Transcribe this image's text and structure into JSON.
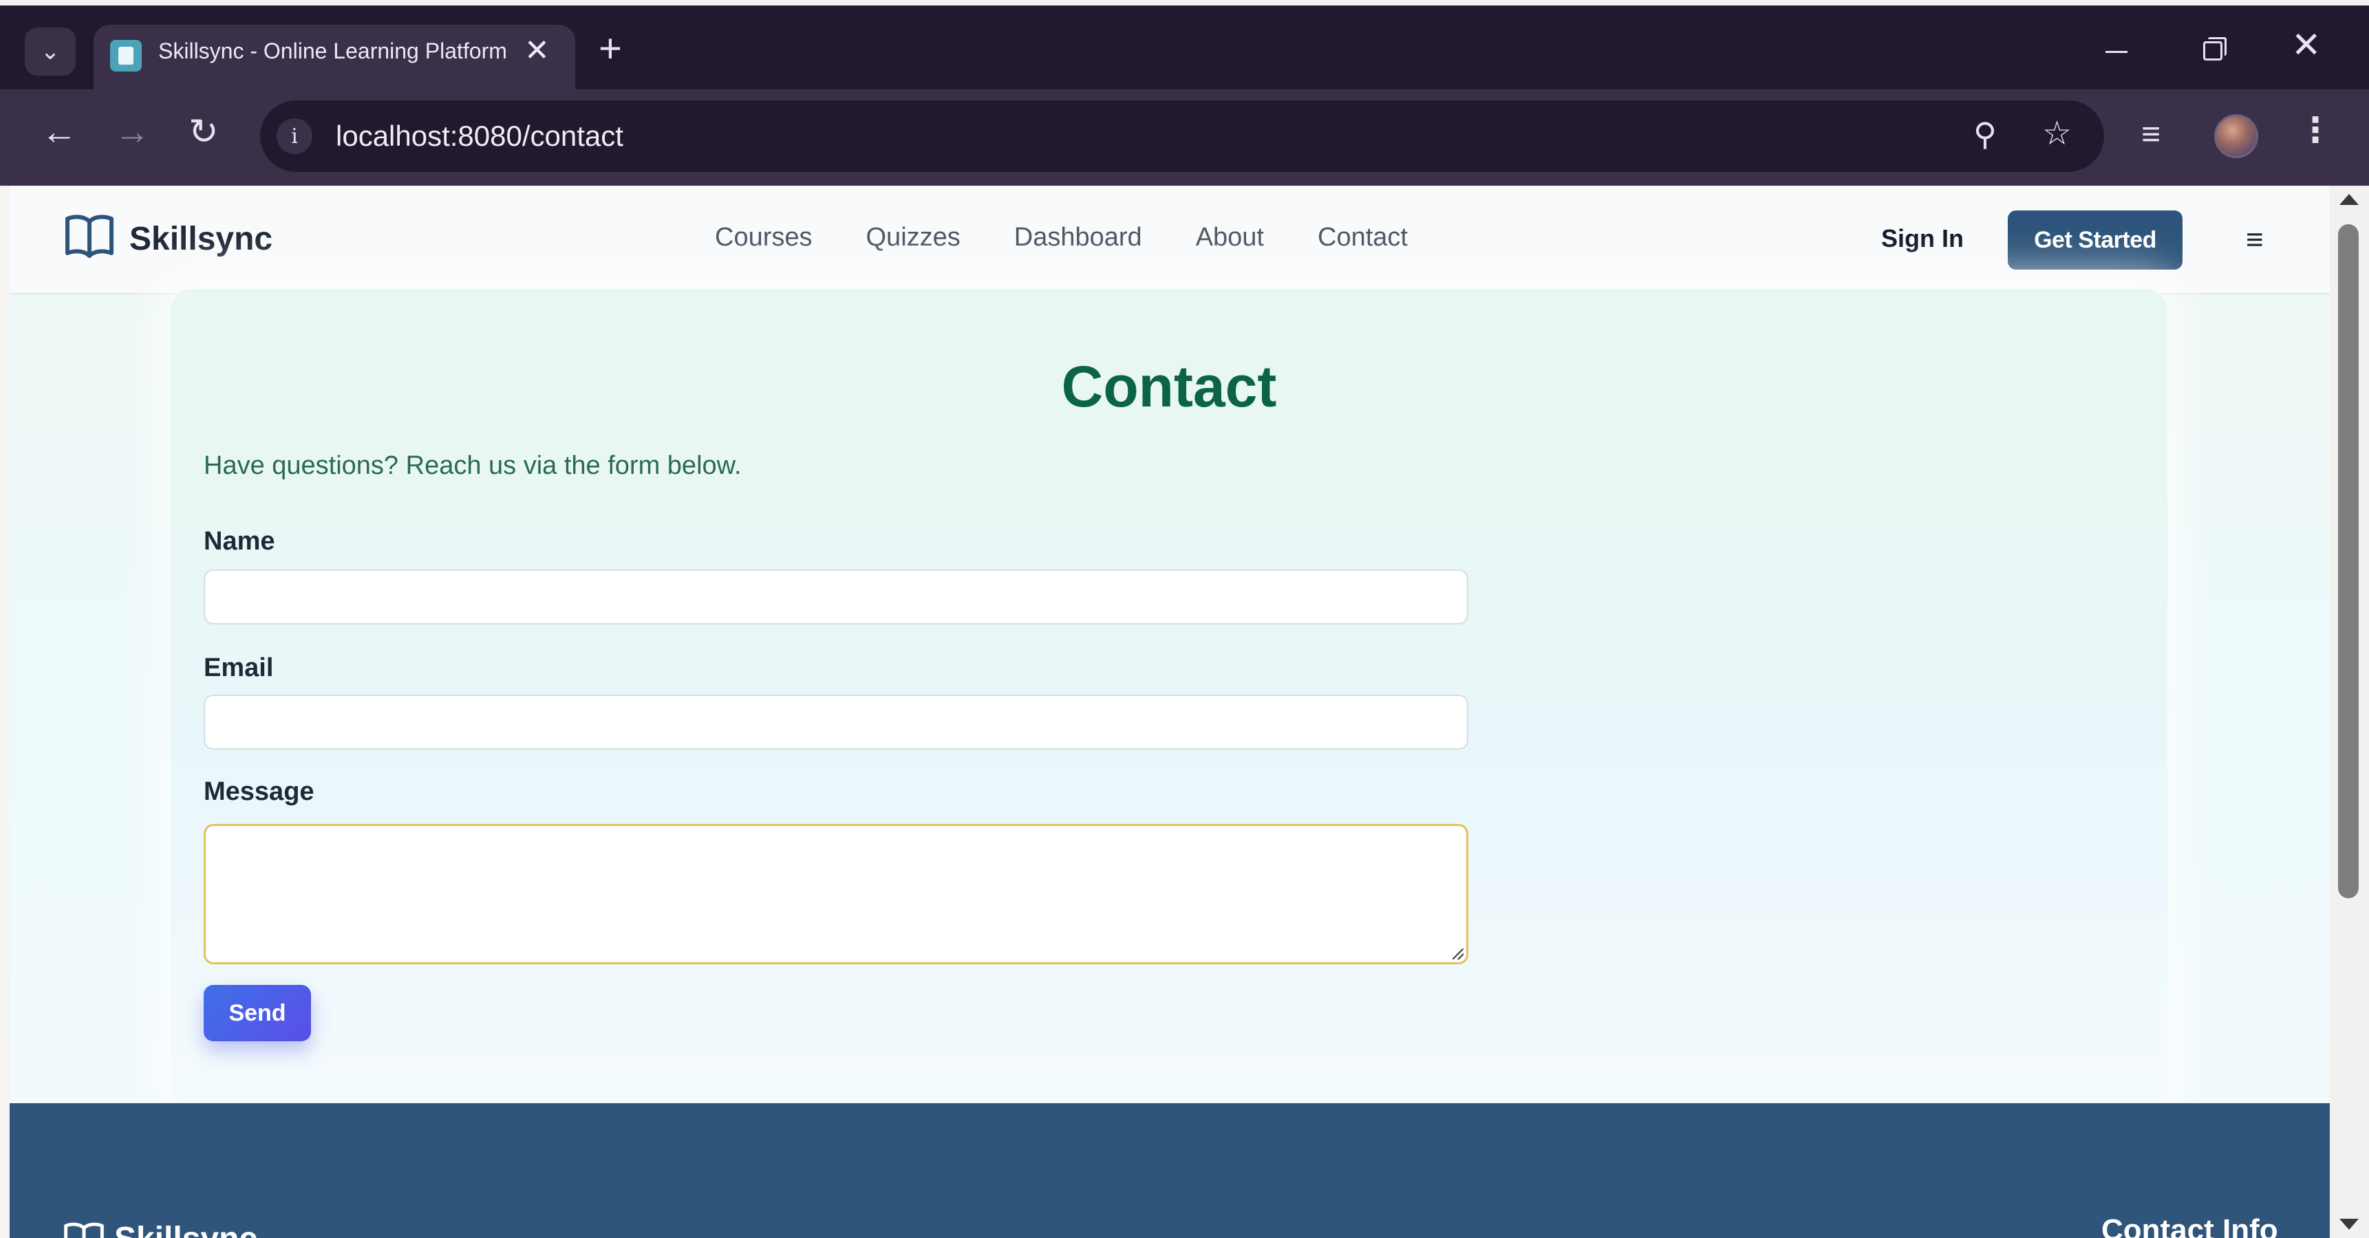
{
  "browser": {
    "tab_title": "Skillsync - Online Learning Platform",
    "url": "localhost:8080/contact"
  },
  "site": {
    "brand": "Skillsync",
    "nav": [
      "Courses",
      "Quizzes",
      "Dashboard",
      "About",
      "Contact"
    ],
    "sign_in": "Sign In",
    "get_started": "Get Started"
  },
  "contact": {
    "title": "Contact",
    "intro": "Have questions? Reach us via the form below.",
    "name_label": "Name",
    "name_value": "",
    "email_label": "Email",
    "email_value": "",
    "message_label": "Message",
    "message_value": "",
    "send_label": "Send"
  },
  "footer": {
    "brand": "Skillsync",
    "contact_info_title": "Contact Info"
  },
  "colors": {
    "header_button": "#2d547a",
    "title_green": "#0b6348",
    "send_button": "#4a5fe7",
    "footer_bg": "#2f557a",
    "focused_border": "#e4c15a"
  },
  "icons": [
    "tab-list-icon",
    "favicon-icon",
    "close-icon",
    "plus-icon",
    "minimize-icon",
    "restore-icon",
    "window-close-icon",
    "back-icon",
    "forward-icon",
    "reload-icon",
    "site-info-icon",
    "zoom-icon",
    "star-icon",
    "media-icon",
    "profile-avatar",
    "more-icon",
    "book-icon",
    "menu-icon"
  ]
}
